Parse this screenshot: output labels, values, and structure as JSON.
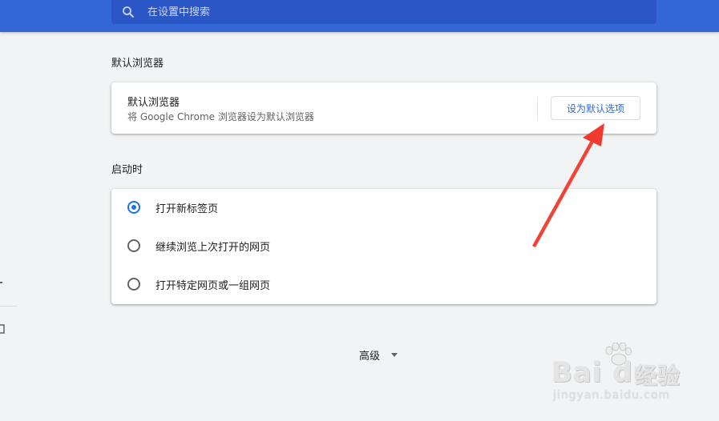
{
  "search": {
    "placeholder": "在设置中搜索",
    "icon": "search-icon"
  },
  "default_browser": {
    "section_title": "默认浏览器",
    "title": "默认浏览器",
    "description": "将 Google Chrome 浏览器设为默认浏览器",
    "button_label": "设为默认选项"
  },
  "startup": {
    "section_title": "启动时",
    "options": [
      {
        "label": "打开新标签页",
        "checked": true
      },
      {
        "label": "继续浏览上次打开的网页",
        "checked": false
      },
      {
        "label": "打开特定网页或一组网页",
        "checked": false
      }
    ]
  },
  "advanced": {
    "label": "高级",
    "icon": "caret-down-icon"
  },
  "watermark": {
    "brand": "Bai du",
    "cn": "经验",
    "url": "jingyan.baidu.com"
  },
  "colors": {
    "header": "#3367d6",
    "search_bg": "#2a56c6",
    "accent": "#1a73e8",
    "annotation_arrow": "#f03a2e"
  }
}
